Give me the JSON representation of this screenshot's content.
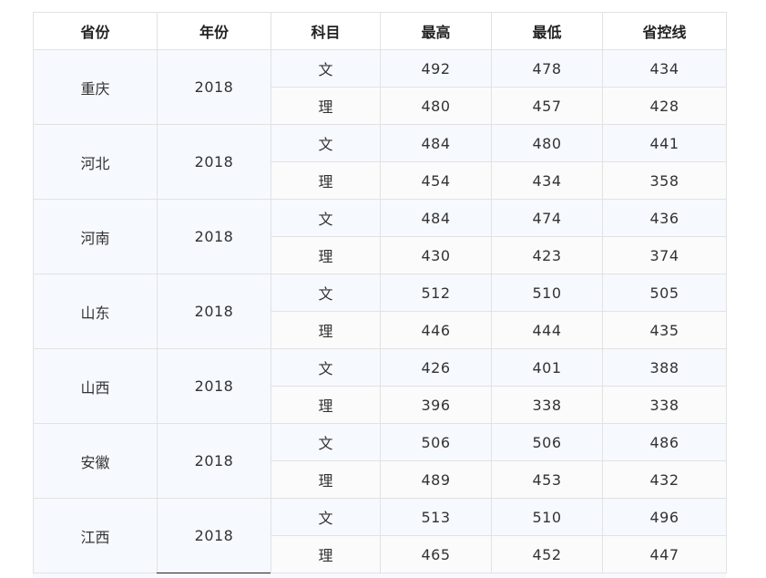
{
  "table": {
    "headers": [
      "省份",
      "年份",
      "科目",
      "最高",
      "最低",
      "省控线"
    ],
    "groups": [
      {
        "province": "重庆",
        "year": "2018",
        "rows": [
          {
            "subject": "文",
            "max": "492",
            "min": "478",
            "line": "434"
          },
          {
            "subject": "理",
            "max": "480",
            "min": "457",
            "line": "428"
          }
        ]
      },
      {
        "province": "河北",
        "year": "2018",
        "rows": [
          {
            "subject": "文",
            "max": "484",
            "min": "480",
            "line": "441"
          },
          {
            "subject": "理",
            "max": "454",
            "min": "434",
            "line": "358"
          }
        ]
      },
      {
        "province": "河南",
        "year": "2018",
        "rows": [
          {
            "subject": "文",
            "max": "484",
            "min": "474",
            "line": "436"
          },
          {
            "subject": "理",
            "max": "430",
            "min": "423",
            "line": "374"
          }
        ]
      },
      {
        "province": "山东",
        "year": "2018",
        "rows": [
          {
            "subject": "文",
            "max": "512",
            "min": "510",
            "line": "505"
          },
          {
            "subject": "理",
            "max": "446",
            "min": "444",
            "line": "435"
          }
        ]
      },
      {
        "province": "山西",
        "year": "2018",
        "rows": [
          {
            "subject": "文",
            "max": "426",
            "min": "401",
            "line": "388"
          },
          {
            "subject": "理",
            "max": "396",
            "min": "338",
            "line": "338"
          }
        ]
      },
      {
        "province": "安徽",
        "year": "2018",
        "rows": [
          {
            "subject": "文",
            "max": "506",
            "min": "506",
            "line": "486"
          },
          {
            "subject": "理",
            "max": "489",
            "min": "453",
            "line": "432"
          }
        ]
      },
      {
        "province": "江西",
        "year": "2018",
        "rows": [
          {
            "subject": "文",
            "max": "513",
            "min": "510",
            "line": "496"
          },
          {
            "subject": "理",
            "max": "465",
            "min": "452",
            "line": "447"
          }
        ]
      }
    ]
  }
}
